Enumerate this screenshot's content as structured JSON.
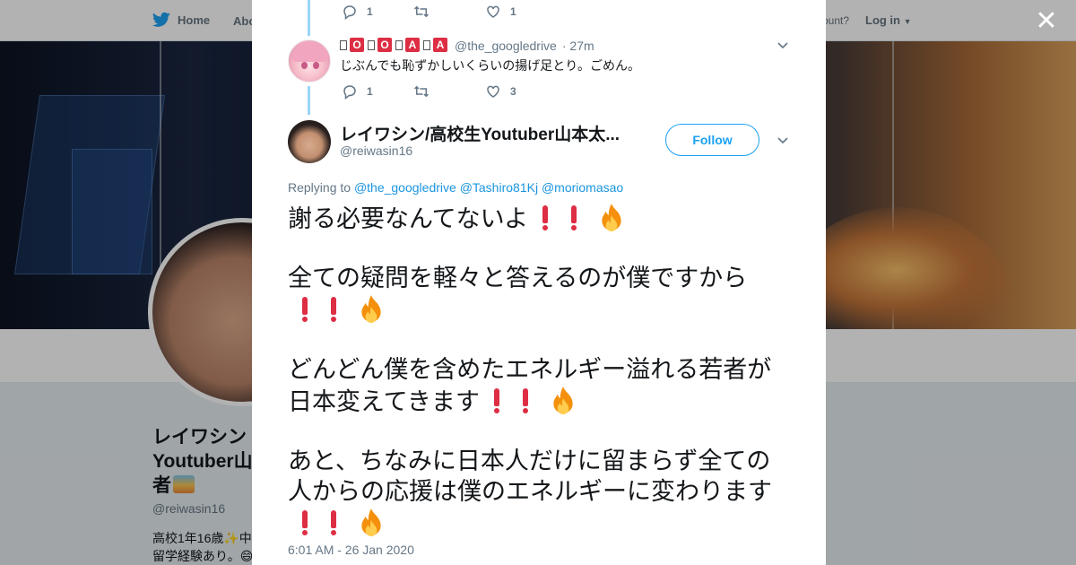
{
  "background": {
    "nav": {
      "home_label": "Home",
      "about_label": "Abo",
      "account_text": "ccount?",
      "login_label": "Log in"
    },
    "profile": {
      "name": "レイワシン/高校生Youtuber山本太郎 有 者🌅",
      "name_line1": "レイワシン",
      "name_line2": "Youtuber山",
      "name_line3": "者",
      "handle": "@reiwasin16",
      "bio_line1": "高校1年16歳✨中",
      "bio_line2": "留学経験あり。😄"
    }
  },
  "modal": {
    "prev_tweet_actions": {
      "replies": "1",
      "likes": "1"
    },
    "reply_tweet": {
      "name_glyphs": [
        "O",
        "O",
        "A",
        "A"
      ],
      "handle": "@the_googledrive",
      "time": "· 27m",
      "text": "じぶんでも恥ずかしいくらいの揚げ足とり。ごめん。",
      "replies": "1",
      "likes": "3"
    },
    "main_tweet": {
      "author_name": "レイワシン/高校生Youtuber山本太...",
      "author_handle": "@reiwasin16",
      "follow_label": "Follow",
      "replying_prefix": "Replying to",
      "mentions": [
        "@the_googledrive",
        "@Tashiro81Kj",
        "@moriomasao"
      ],
      "paragraphs": [
        "謝る必要なんてないよ",
        "全ての疑問を軽々と答えるのが僕ですから",
        "どんどん僕を含めたエネルギー溢れる若者が日本変えてきます",
        "あと、ちなみに日本人だけに留まらず全ての人からの応援は僕のエネルギーに変わります"
      ],
      "timestamp": "6:01 AM - 26 Jan 2020"
    }
  },
  "colors": {
    "twitter_blue": "#1da1f2",
    "mention_blue": "#1b95e0",
    "thread_line": "#9ad4f7",
    "gray_text": "#657786",
    "emoji_red": "#dd2e44"
  },
  "icons": [
    "twitter-bird-icon",
    "close-icon",
    "reply-icon",
    "retweet-icon",
    "like-icon",
    "chevron-down-icon",
    "exclamation-emoji-icon",
    "fire-emoji-icon"
  ]
}
